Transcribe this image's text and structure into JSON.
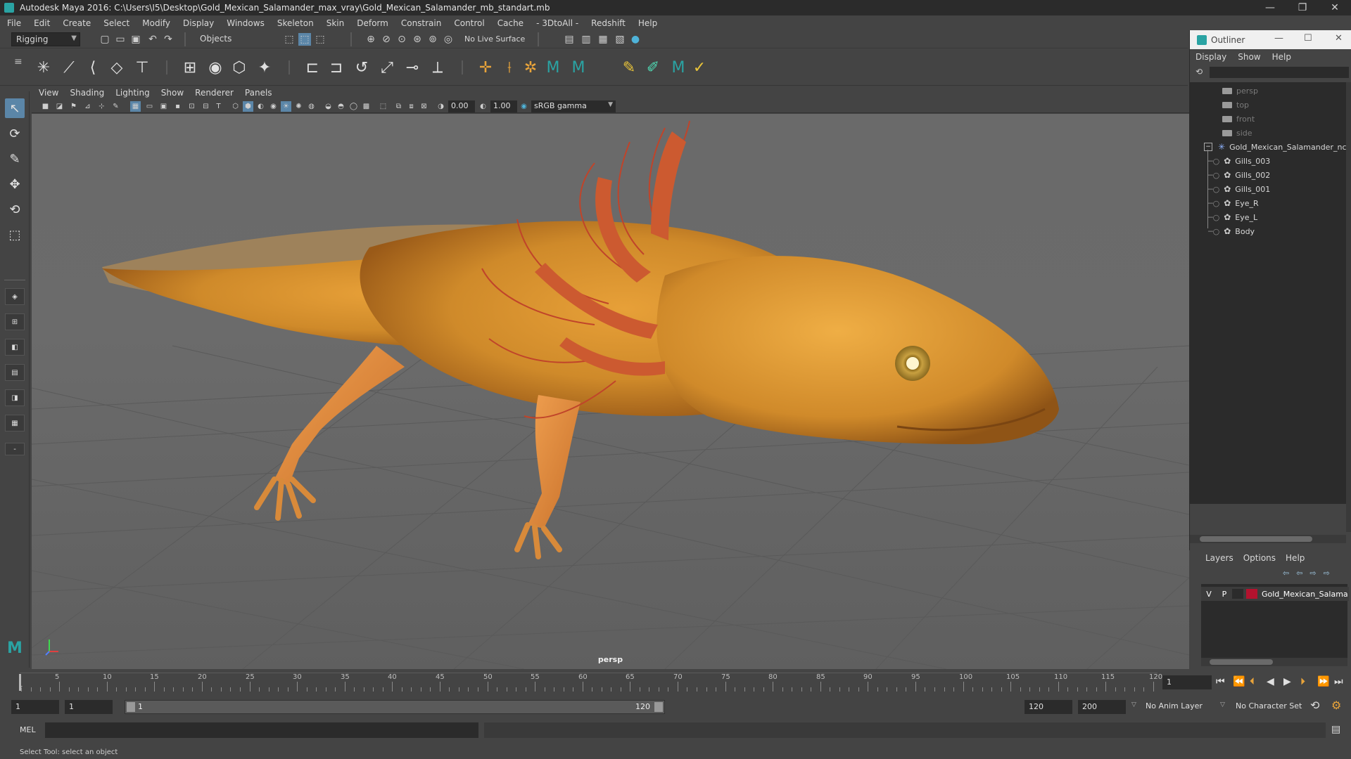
{
  "window": {
    "title": "Autodesk Maya 2016: C:\\Users\\I5\\Desktop\\Gold_Mexican_Salamander_max_vray\\Gold_Mexican_Salamander_mb_standart.mb",
    "min": "—",
    "max": "❐",
    "close": "✕"
  },
  "menubar": [
    "File",
    "Edit",
    "Create",
    "Select",
    "Modify",
    "Display",
    "Windows",
    "Skeleton",
    "Skin",
    "Deform",
    "Constrain",
    "Control",
    "Cache",
    "- 3DtoAll -",
    "Redshift",
    "Help"
  ],
  "statusline": {
    "mode": "Rigging",
    "selection_mode": "Objects",
    "live_surface": "No Live Surface"
  },
  "panel": {
    "menu": [
      "View",
      "Shading",
      "Lighting",
      "Show",
      "Renderer",
      "Panels"
    ],
    "exposure": "0.00",
    "gamma": "1.00",
    "colorspace": "sRGB gamma",
    "camera_label": "persp"
  },
  "outliner": {
    "title": "Outliner",
    "menu": [
      "Display",
      "Show",
      "Help"
    ],
    "cameras": [
      "persp",
      "top",
      "front",
      "side"
    ],
    "root": "Gold_Mexican_Salamander_ncl",
    "children": [
      "Gills_003",
      "Gills_002",
      "Gills_001",
      "Eye_R",
      "Eye_L",
      "Body"
    ]
  },
  "layers": {
    "menu": [
      "Layers",
      "Options",
      "Help"
    ],
    "row": {
      "v": "V",
      "p": "P",
      "name": "Gold_Mexican_Salama",
      "color": "#b3122e"
    }
  },
  "timeline": {
    "ticks": [
      "5",
      "10",
      "15",
      "20",
      "25",
      "30",
      "35",
      "40",
      "45",
      "50",
      "55",
      "60",
      "65",
      "70",
      "75",
      "80",
      "85",
      "90",
      "95",
      "100",
      "105",
      "110",
      "115",
      "120"
    ],
    "start_label": "1",
    "current_frame": "1"
  },
  "range": {
    "start": "1",
    "playback_start": "1",
    "slider_start": "1",
    "slider_end": "120",
    "playback_end": "120",
    "end": "200",
    "anim_layer": "No Anim Layer",
    "char_set": "No Character Set"
  },
  "cmdline": {
    "label": "MEL"
  },
  "helpline": {
    "text": "Select Tool: select an object"
  },
  "colors": {
    "accent": "#2aa3a3",
    "body": "#d08a2a",
    "gills": "#c0442a"
  }
}
